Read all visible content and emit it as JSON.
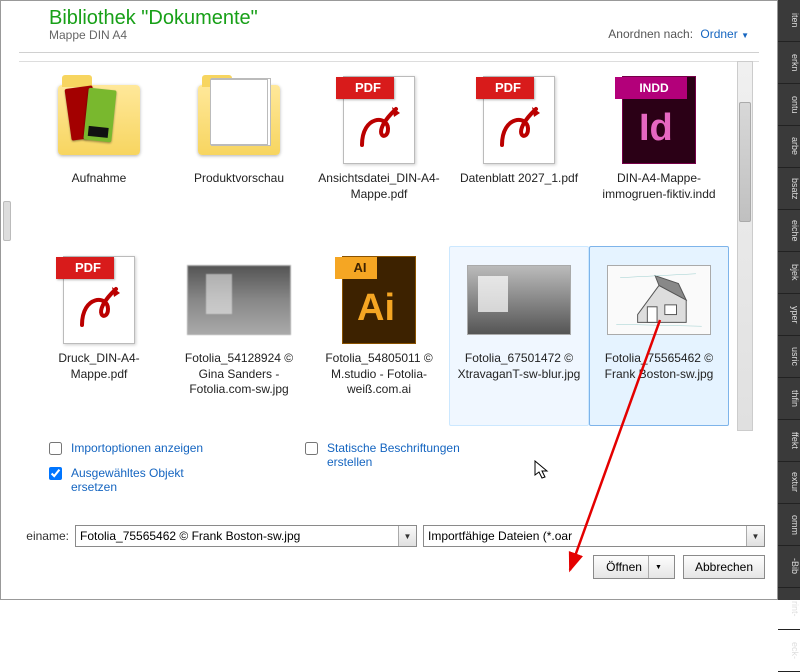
{
  "header": {
    "title": "Bibliothek \"Dokumente\"",
    "subtitle": "Mappe DIN A4",
    "arrange_label": "Anordnen nach:",
    "arrange_value": "Ordner"
  },
  "items": [
    {
      "label": "Aufnahme",
      "kind": "folder-color"
    },
    {
      "label": "Produktvorschau",
      "kind": "folder-pages"
    },
    {
      "label": "Ansichtsdatei_DIN-A4-Mappe.pdf",
      "kind": "pdf",
      "band": "PDF"
    },
    {
      "label": "Datenblatt 2027_1.pdf",
      "kind": "pdf",
      "band": "PDF"
    },
    {
      "label": "DIN-A4-Mappe-immogruen-fiktiv.indd",
      "kind": "indd",
      "band": "INDD",
      "glyph": "Id"
    },
    {
      "label": "Druck_DIN-A4-Mappe.pdf",
      "kind": "pdf",
      "band": "PDF"
    },
    {
      "label": "Fotolia_54128924 © Gina Sanders - Fotolia.com-sw.jpg",
      "kind": "img-blur"
    },
    {
      "label": "Fotolia_54805011 © M.studio - Fotolia-weiß.com.ai",
      "kind": "ai",
      "band": "AI",
      "glyph": "Ai"
    },
    {
      "label": "Fotolia_67501472 © XtravaganT-sw-blur.jpg",
      "kind": "img-room"
    },
    {
      "label": "Fotolia_75565462 © Frank Boston-sw.jpg",
      "kind": "img-house"
    }
  ],
  "selection_index": 9,
  "hover_index": 8,
  "checkboxes": {
    "import_options": {
      "label": "Importoptionen anzeigen",
      "checked": false
    },
    "replace_selected": {
      "label": "Ausgewähltes Objekt ersetzen",
      "checked": true
    },
    "static_captions": {
      "label": "Statische Beschriftungen erstellen",
      "checked": false
    }
  },
  "footer": {
    "filename_label": "einame:",
    "filename_value": "Fotolia_75565462 © Frank Boston-sw.jpg",
    "filter_value": "Importfähige Dateien (*.oar",
    "open_label": "Öffnen",
    "cancel_label": "Abbrechen"
  },
  "sidebar_tabs": [
    "iten",
    "erkn",
    "ontu",
    "arbe",
    "bsatz",
    "eiche",
    "bjek",
    "yper",
    "usric",
    "thfin",
    "ffekt",
    "extur",
    "omm",
    "-Bib",
    "rint-",
    "eck-"
  ]
}
